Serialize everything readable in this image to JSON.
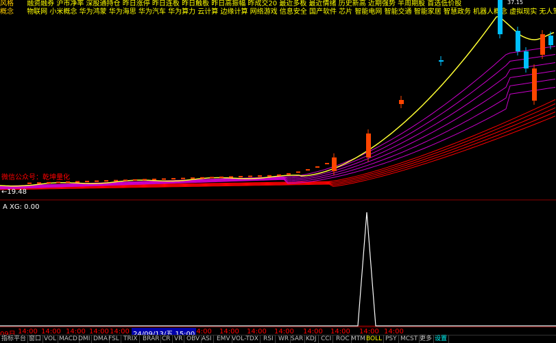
{
  "concept_lines": {
    "line1_prefix": "风格",
    "line1_text": "融资融券 沪市净率 深股通持仓 昨日涨停 昨日连板 昨日触板 昨日高振幅 昨成交20 最近多板 最近情绪 历史新高 近期强势 半周期股 首选低价股",
    "line2_prefix": "概念",
    "line2_text": "物联网 小米概念 华为鸿蒙 华为海思 华为汽车 华为算力 云计算 边缘计算 网络游戏 信息安全 国产软件 芯片 智能电网 智能交通 智能家居 智慧政务 机器人概念 虚拟现实 无人驾驶 区块链 数字货币 人工智能 操作系统"
  },
  "chart_labels": {
    "upper_note": "微信公众号：乾坤量化",
    "price_low_label": "←19.48",
    "price_high_label": "37.15",
    "sub_indicator": "A  XG: 0.00"
  },
  "time_axis": {
    "labels": [
      "09日",
      "14:00",
      "14:00",
      "14:00",
      "14:00",
      "14:00",
      "14:00",
      "14:00",
      "14:00",
      "14:00",
      "14:00",
      "14:00",
      "14:00",
      "14:00",
      "14:00"
    ],
    "cursor_label": "24/09/13/五  15:00"
  },
  "tabs": [
    "指标平台",
    "窗口",
    "VOL",
    "MACD",
    "DMI",
    "DMA",
    "FSL",
    "TRIX",
    "BRAR",
    "CR",
    "VR",
    "OBV",
    "ASI",
    "EMV",
    "VOL-TDX",
    "RSI",
    "WR",
    "SAR",
    "KDJ",
    "CCI",
    "ROC",
    "MTM",
    "BOLL",
    "PSY",
    "MCST",
    "更多",
    "设置"
  ],
  "colors": {
    "up": "#ff4500",
    "down": "#00bfff",
    "ma_fast": "#ffff33",
    "ma_band": "#cc00cc",
    "ma_slow": "#ff0000",
    "sub_line": "#ffffff"
  },
  "chart_data": {
    "type": "candlestick",
    "note": "price bars recreated as approximate values; only high/low prices printed on chart",
    "price_low": 19.48,
    "price_high": 37.15,
    "sub_indicator_values": [
      0,
      0,
      0,
      0,
      0,
      0,
      0,
      0,
      0,
      0,
      0,
      0,
      0,
      0,
      0,
      0,
      0,
      0,
      0,
      0,
      0,
      0,
      0,
      0,
      0,
      0,
      0,
      0,
      0,
      0,
      0,
      0,
      0,
      0,
      0,
      0,
      0,
      0,
      0,
      0,
      0,
      0,
      0,
      0,
      0,
      0,
      0,
      0,
      0,
      0,
      0,
      0,
      0,
      0,
      0,
      0,
      0,
      0,
      0,
      0,
      0,
      0,
      0,
      0,
      0,
      0,
      0,
      0,
      0,
      0,
      0,
      0,
      0,
      0,
      0,
      0,
      0,
      0,
      0,
      0,
      0,
      0,
      0,
      0,
      0,
      0,
      0,
      0,
      0,
      0,
      0,
      0,
      0,
      0,
      0,
      0,
      0,
      0,
      0,
      0,
      0,
      0,
      0,
      0,
      0,
      0,
      0,
      0,
      0,
      0,
      0,
      0,
      0,
      0,
      0,
      0,
      0,
      0,
      0,
      0,
      1,
      0,
      0,
      0,
      0,
      0,
      0,
      0,
      0,
      0,
      0,
      0,
      0,
      0,
      0,
      0,
      0,
      0,
      0,
      0,
      0,
      0,
      0,
      0,
      0,
      0,
      0,
      0,
      0,
      0,
      0,
      0,
      0,
      0,
      0,
      0,
      0,
      0,
      0,
      0,
      0,
      0,
      0,
      0,
      0,
      0,
      0,
      0,
      0,
      0,
      0,
      0,
      0,
      0,
      0,
      0,
      0,
      0,
      0,
      0
    ]
  }
}
